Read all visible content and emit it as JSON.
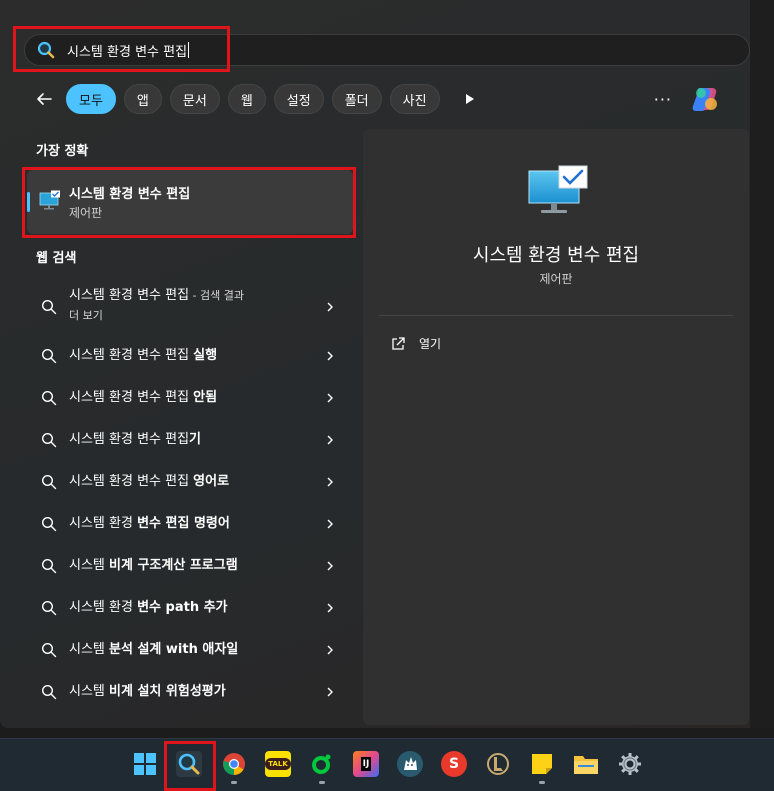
{
  "search": {
    "query": "시스템 환경 변수 편집"
  },
  "filters": {
    "items": [
      {
        "label": "모두",
        "active": true
      },
      {
        "label": "앱"
      },
      {
        "label": "문서"
      },
      {
        "label": "웹"
      },
      {
        "label": "설정"
      },
      {
        "label": "폴더"
      },
      {
        "label": "사진"
      }
    ],
    "more_label": "···"
  },
  "best_match": {
    "section_label": "가장 정확",
    "title": "시스템 환경 변수 편집",
    "subtitle": "제어판"
  },
  "web_search": {
    "section_label": "웹 검색",
    "items": [
      {
        "main": "시스템 환경 변수 편집",
        "suffix": " - 검색 결과",
        "line2": "더 보기"
      },
      {
        "main": "시스템 환경 변수 편집 ",
        "bold": "실행"
      },
      {
        "main": "시스템 환경 변수 편집 ",
        "bold": "안됨"
      },
      {
        "main": "시스템 환경 변수 편집",
        "bold": "기"
      },
      {
        "main": "시스템 환경 변수 편집 ",
        "bold": "영어로"
      },
      {
        "main": "시스템 환경",
        "bold": "변수 편집 명령어",
        "sep": ""
      },
      {
        "main": "시스템 ",
        "bold": "비계 구조계산 프로그램"
      },
      {
        "main": "시스템 환경",
        "bold": "변수 path 추가",
        "sep": ""
      },
      {
        "main": "시스템 ",
        "bold": "분석 설계 with 애자일"
      },
      {
        "main": "시스템 ",
        "bold": "비계 설치 위험성평가"
      }
    ]
  },
  "detail": {
    "title": "시스템 환경 변수 편집",
    "subtitle": "제어판",
    "open_label": "열기"
  },
  "taskbar": {
    "kakao_label": "TALK",
    "intellij_label": "IJ",
    "s_label": "S"
  },
  "colors": {
    "accent": "#4cc2ff",
    "highlight_box": "#e0141b"
  }
}
